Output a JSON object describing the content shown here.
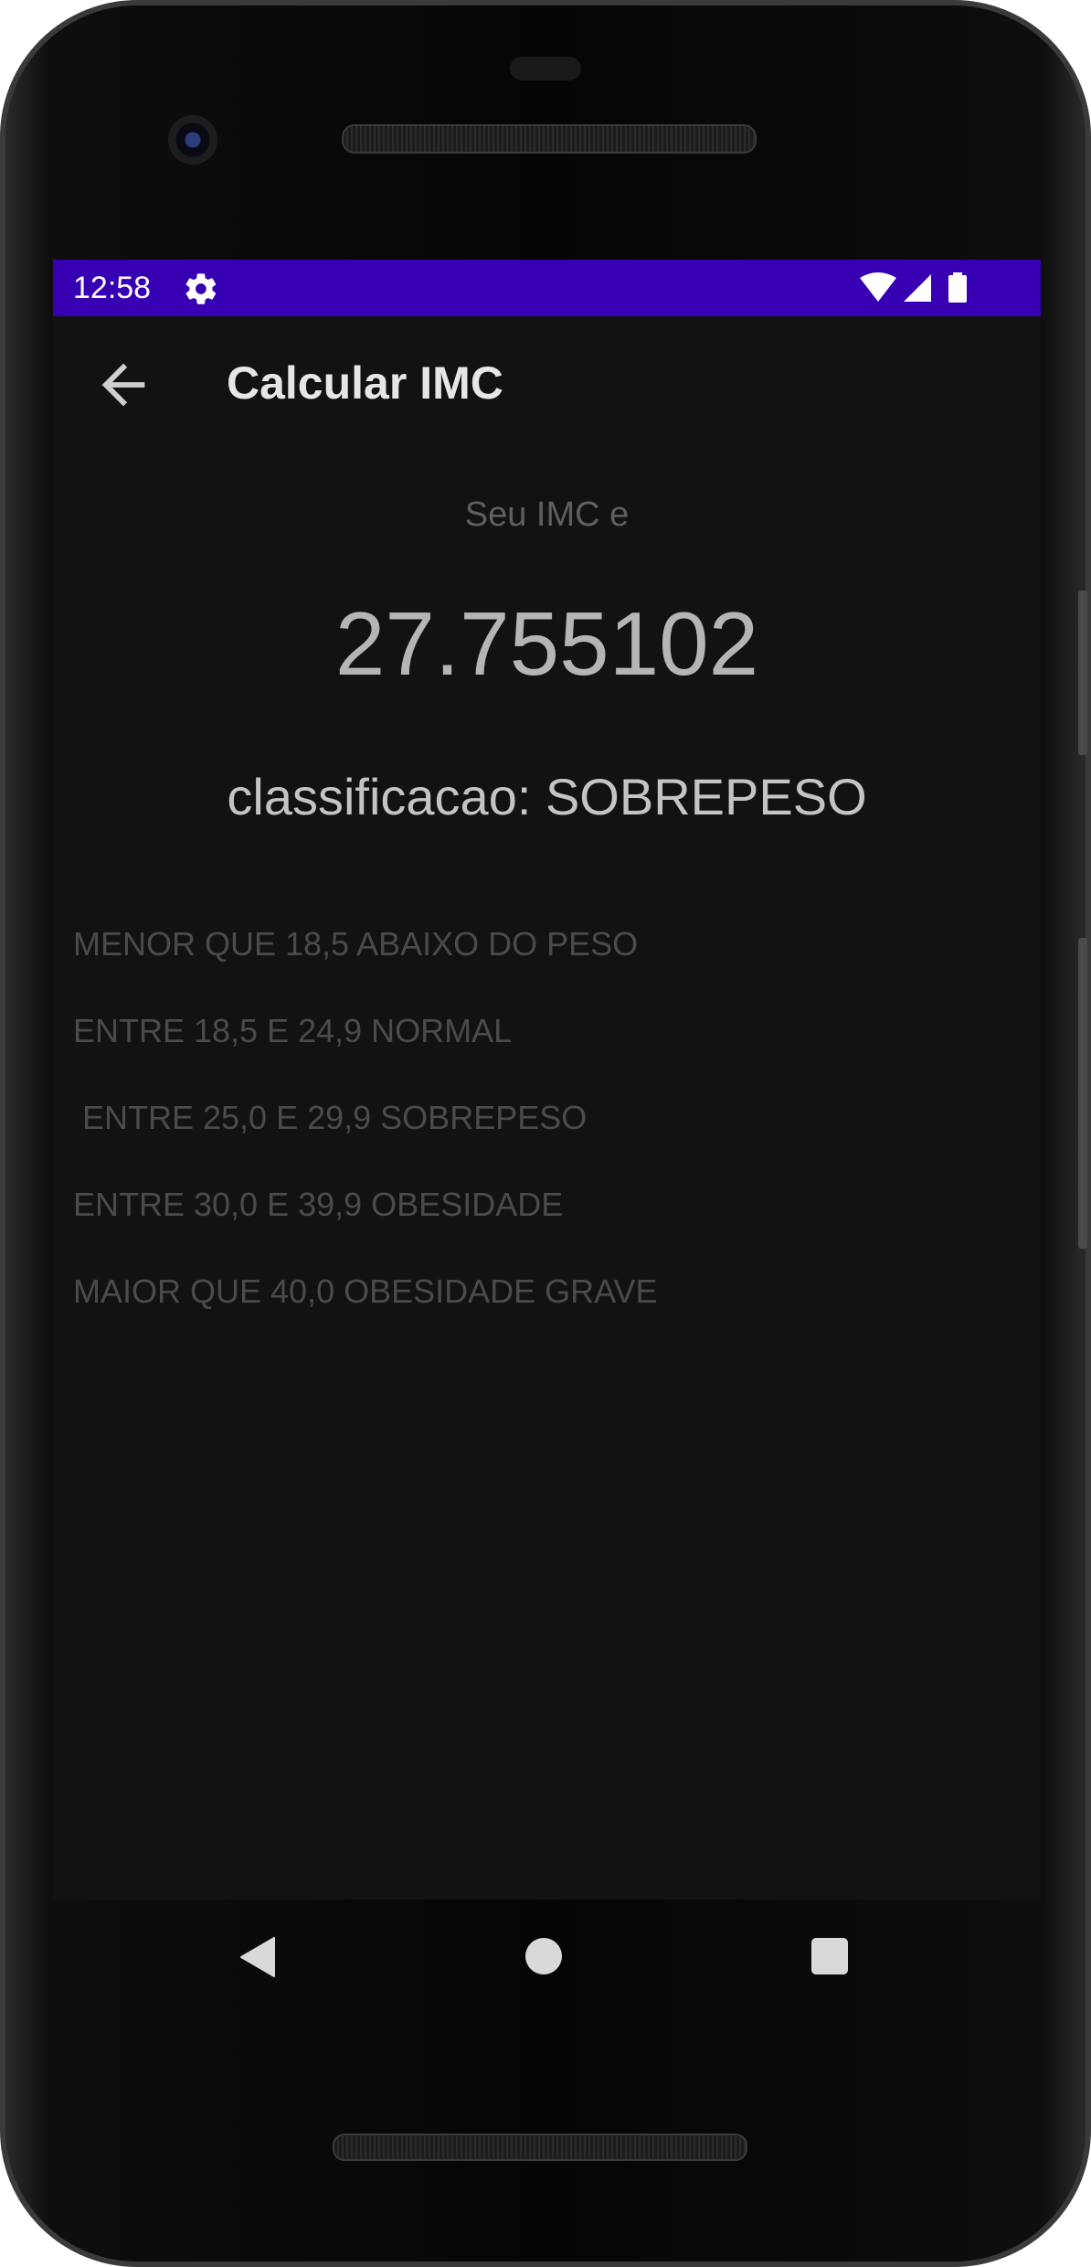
{
  "status_bar": {
    "time": "12:58",
    "background_color": "#3700b3",
    "icons": [
      "settings-icon",
      "wifi-icon",
      "signal-icon",
      "battery-icon"
    ]
  },
  "app_bar": {
    "title": "Calcular IMC",
    "back_icon": "arrow-back-icon"
  },
  "result": {
    "label": "Seu IMC e",
    "value": "27.755102",
    "classification": "classificacao: SOBREPESO"
  },
  "ranges": [
    "MENOR QUE 18,5 ABAIXO DO PESO",
    "ENTRE 18,5 E 24,9 NORMAL",
    " ENTRE 25,0 E 29,9 SOBREPESO",
    "ENTRE 30,0 E 39,9 OBESIDADE",
    "MAIOR QUE 40,0 OBESIDADE GRAVE"
  ],
  "nav_bar": {
    "icons": [
      "nav-back-icon",
      "nav-home-icon",
      "nav-recents-icon"
    ]
  }
}
